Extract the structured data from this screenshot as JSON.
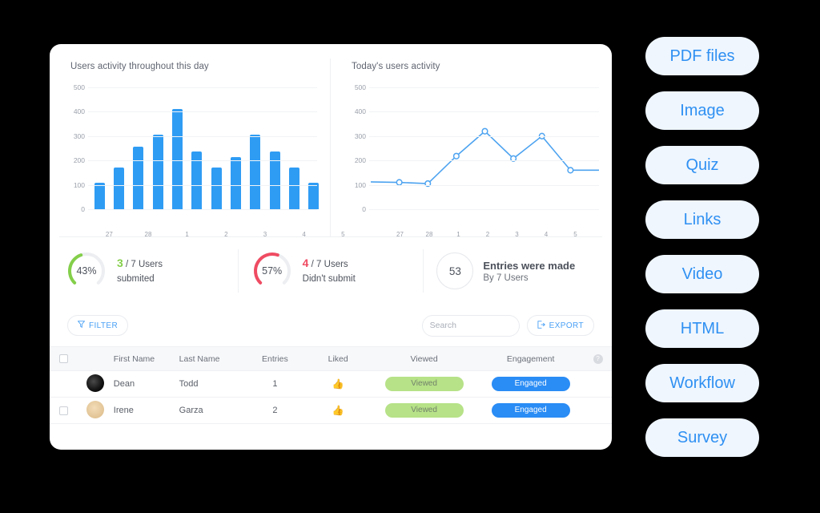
{
  "charts": {
    "bar": {
      "title": "Users activity throughout this day",
      "yticks": [
        "0",
        "100",
        "200",
        "300",
        "400",
        "500"
      ],
      "xticks": [
        "27",
        "28",
        "1",
        "2",
        "3",
        "4",
        "5"
      ]
    },
    "line": {
      "title": "Today's users activity",
      "yticks": [
        "0",
        "100",
        "200",
        "300",
        "400",
        "500"
      ],
      "xticks": [
        "27",
        "28",
        "1",
        "2",
        "3",
        "4",
        "5"
      ]
    }
  },
  "chart_data": [
    {
      "type": "bar",
      "title": "Users activity throughout this day",
      "xlabel": "",
      "ylabel": "",
      "ylim": [
        0,
        500
      ],
      "yticks": [
        0,
        100,
        200,
        300,
        400,
        500
      ],
      "grid": true,
      "legend": "none",
      "categories": [
        "",
        "27",
        "",
        "28",
        "",
        "1",
        "",
        "2",
        "",
        "3",
        "",
        "4",
        "",
        "5",
        ""
      ],
      "tick_labels": [
        "27",
        "28",
        "1",
        "2",
        "3",
        "4",
        "5"
      ],
      "values": [
        110,
        170,
        258,
        305,
        410,
        237,
        170,
        213,
        305,
        237,
        170,
        110
      ],
      "bar_color": "#2f9cf4"
    },
    {
      "type": "line",
      "title": "Today's users activity",
      "xlabel": "",
      "ylabel": "",
      "ylim": [
        0,
        500
      ],
      "yticks": [
        0,
        100,
        200,
        300,
        400,
        500
      ],
      "grid": true,
      "legend": "none",
      "tick_labels": [
        "27",
        "28",
        "1",
        "2",
        "3",
        "4",
        "5"
      ],
      "x": [
        0,
        1,
        2,
        3,
        4,
        5,
        6,
        7,
        8
      ],
      "values": [
        112,
        110,
        105,
        218,
        320,
        208,
        300,
        160,
        160
      ],
      "markers": [
        null,
        110,
        105,
        218,
        320,
        208,
        300,
        160,
        null
      ],
      "line_color": "#4da3f0",
      "marker_color": "#ffffff"
    }
  ],
  "stats": [
    {
      "percent": "43%",
      "percent_value": 43,
      "count": "3",
      "rest": "/ 7 Users",
      "line2": "submited",
      "color": "#84cf4a"
    },
    {
      "percent": "57%",
      "percent_value": 57,
      "count": "4",
      "rest": "/ 7 Users",
      "line2": "Didn't submit",
      "color": "#ef4b62"
    }
  ],
  "entries": {
    "number": "53",
    "headline": "Entries were made",
    "subline": "By 7 Users"
  },
  "toolbar": {
    "filter_label": "FILTER",
    "export_label": "EXPORT",
    "search_placeholder": "Search",
    "search_value": ""
  },
  "table": {
    "headers": [
      "First Name",
      "Last Name",
      "Entries",
      "Liked",
      "Viewed",
      "Engagement"
    ],
    "rows": [
      {
        "first": "Dean",
        "last": "Todd",
        "entries": "1",
        "liked": "\u0001",
        "viewed": "Viewed",
        "engagement": "Engaged",
        "avatar": "dark",
        "checked": false
      },
      {
        "first": "Irene",
        "last": "Garza",
        "entries": "2",
        "liked": "\u0001",
        "viewed": "Viewed",
        "engagement": "Engaged",
        "avatar": "tan",
        "checked": false
      }
    ]
  },
  "side_pills": [
    "PDF files",
    "Image",
    "Quiz",
    "Links",
    "Video",
    "HTML",
    "Workflow",
    "Survey"
  ],
  "colors": {
    "accent_blue": "#2f90f2",
    "bar_blue": "#2f9cf4",
    "green": "#84cf4a",
    "red": "#ef4b62",
    "badge_green": "#b7e288",
    "badge_blue": "#2a8cf5",
    "pill_bg": "#eff6fe",
    "page_bg": "#000000",
    "card_bg": "#ffffff"
  }
}
